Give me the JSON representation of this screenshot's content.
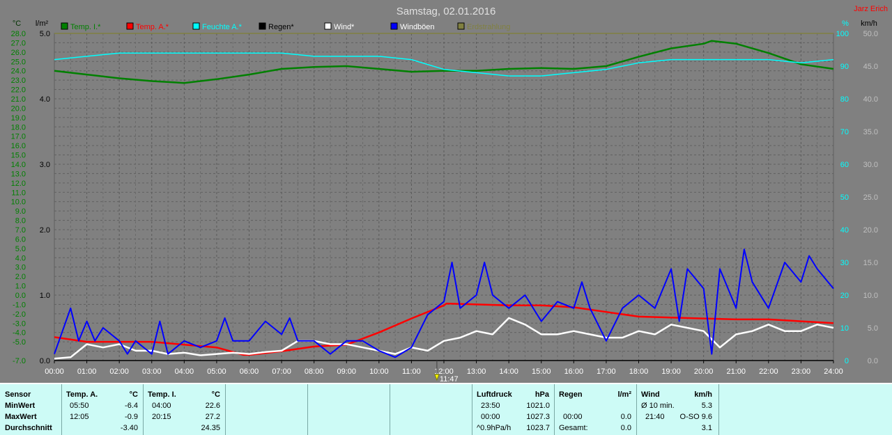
{
  "header": {
    "title": "Samstag, 02.01.2016",
    "author": "Jarz Erich"
  },
  "axes": {
    "left_unit_1": "°C",
    "left_unit_2": "l/m²",
    "right_unit_1": "%",
    "right_unit_2": "km/h",
    "temp_ticks": [
      "28.0",
      "27.0",
      "26.0",
      "25.0",
      "24.0",
      "23.0",
      "22.0",
      "21.0",
      "20.0",
      "19.0",
      "18.0",
      "17.0",
      "16.0",
      "15.0",
      "14.0",
      "13.0",
      "12.0",
      "11.0",
      "10.0",
      "9.0",
      "8.0",
      "7.0",
      "6.0",
      "5.0",
      "4.0",
      "3.0",
      "2.0",
      "1.0",
      "0.0",
      "-1.0",
      "-2.0",
      "-3.0",
      "-4.0",
      "-5.0",
      "-7.0"
    ],
    "rain_ticks": [
      "5.0",
      "4.0",
      "3.0",
      "2.0",
      "1.0",
      "0.0"
    ],
    "humidity_ticks": [
      "100",
      "90",
      "80",
      "70",
      "60",
      "50",
      "40",
      "30",
      "20",
      "10",
      "0"
    ],
    "wind_ticks": [
      "50.0",
      "45.0",
      "40.0",
      "35.0",
      "30.0",
      "25.0",
      "20.0",
      "15.0",
      "10.0",
      "5.0",
      "0.0"
    ],
    "time_ticks": [
      "00:00",
      "01:00",
      "02:00",
      "03:00",
      "04:00",
      "05:00",
      "06:00",
      "07:00",
      "08:00",
      "09:00",
      "10:00",
      "11:00",
      "12:00",
      "13:00",
      "14:00",
      "15:00",
      "16:00",
      "17:00",
      "18:00",
      "19:00",
      "20:00",
      "21:00",
      "22:00",
      "23:00",
      "24:00"
    ],
    "marker_label": "11:47"
  },
  "colors": {
    "temp_indoor": "#008000",
    "temp_outdoor": "#ff0000",
    "humidity": "#00ffff",
    "rain": "#000000",
    "wind": "#ffffff",
    "gusts": "#0000ff",
    "lightning": "#808040",
    "axis_temp": "#008000",
    "axis_rain": "#000000",
    "axis_humidity": "#00ffff",
    "axis_wind": "#c0c0c0"
  },
  "chart_data": {
    "type": "line",
    "title": "Samstag, 02.01.2016",
    "x_range": [
      "00:00",
      "24:00"
    ],
    "y_temp_range": [
      -7.0,
      28.0
    ],
    "y_rain_range": [
      0.0,
      5.0
    ],
    "y_humidity_range": [
      0,
      100
    ],
    "y_wind_range": [
      0.0,
      50.0
    ],
    "grid": true,
    "legend_position": "top",
    "series": [
      {
        "name": "Temp. I.*",
        "color_key": "temp_indoor",
        "axis": "temp",
        "x": [
          0,
          1,
          2,
          3,
          4,
          5,
          6,
          7,
          8,
          9,
          10,
          11,
          12,
          13,
          14,
          15,
          16,
          17,
          18,
          19,
          20,
          20.25,
          21,
          22,
          23,
          24
        ],
        "y": [
          24.0,
          23.6,
          23.2,
          22.9,
          22.7,
          23.1,
          23.6,
          24.2,
          24.4,
          24.5,
          24.2,
          23.9,
          24.0,
          24.0,
          24.2,
          24.3,
          24.2,
          24.5,
          25.5,
          26.4,
          26.9,
          27.2,
          26.9,
          25.9,
          24.7,
          24.2
        ]
      },
      {
        "name": "Temp. A.*",
        "color_key": "temp_outdoor",
        "axis": "temp",
        "x": [
          0,
          1,
          2,
          3,
          4,
          5,
          5.83,
          6,
          7,
          8,
          9,
          10,
          11,
          12,
          12.08,
          13,
          14,
          15,
          16,
          17,
          18,
          19,
          20,
          21,
          22,
          23,
          24
        ],
        "y": [
          -4.5,
          -5.0,
          -5.0,
          -5.0,
          -5.3,
          -5.6,
          -6.4,
          -6.4,
          -6.0,
          -5.5,
          -5.3,
          -4.0,
          -2.5,
          -1.1,
          -0.9,
          -1.0,
          -1.1,
          -1.1,
          -1.3,
          -1.8,
          -2.3,
          -2.4,
          -2.5,
          -2.6,
          -2.6,
          -2.8,
          -3.0
        ]
      },
      {
        "name": "Feuchte A.*",
        "color_key": "humidity",
        "axis": "humidity",
        "x": [
          0,
          1,
          2,
          3,
          4,
          5,
          6,
          7,
          8,
          9,
          10,
          11,
          12,
          13,
          14,
          15,
          16,
          17,
          18,
          19,
          20,
          21,
          22,
          23,
          24
        ],
        "y": [
          92,
          93,
          94,
          94,
          94,
          94,
          94,
          94,
          93,
          93,
          93,
          92,
          89,
          88,
          87,
          87,
          88,
          89,
          91,
          92,
          92,
          92,
          92,
          91,
          92
        ]
      },
      {
        "name": "Regen*",
        "color_key": "rain",
        "axis": "rain",
        "x": [
          0,
          24
        ],
        "y": [
          0.0,
          0.0
        ]
      },
      {
        "name": "Wind*",
        "color_key": "wind",
        "axis": "wind",
        "x": [
          0,
          0.5,
          1,
          1.5,
          2,
          2.5,
          3,
          3.5,
          4,
          4.5,
          5,
          5.5,
          6,
          6.5,
          7,
          7.5,
          8,
          8.5,
          9,
          9.5,
          10,
          10.5,
          11,
          11.5,
          12,
          12.5,
          13,
          13.5,
          14,
          14.5,
          15,
          15.5,
          16,
          16.5,
          17,
          17.5,
          18,
          18.5,
          19,
          19.5,
          20,
          20.5,
          21,
          21.5,
          22,
          22.5,
          23,
          23.5,
          24
        ],
        "y": [
          0.3,
          0.5,
          2.5,
          2.0,
          2.5,
          1.5,
          1.5,
          1.0,
          1.2,
          0.8,
          1.0,
          1.2,
          1.0,
          1.3,
          1.5,
          3.0,
          3.0,
          2.5,
          2.5,
          2.0,
          1.5,
          1.0,
          2.0,
          1.5,
          3.0,
          3.5,
          4.5,
          4.0,
          6.5,
          5.5,
          4.0,
          4.0,
          4.5,
          4.0,
          3.5,
          3.5,
          4.5,
          4.0,
          5.5,
          5.0,
          4.5,
          2.0,
          4.0,
          4.5,
          5.5,
          4.5,
          4.5,
          5.5,
          5.0
        ]
      },
      {
        "name": "Windböen",
        "color_key": "gusts",
        "axis": "wind",
        "x": [
          0,
          0.5,
          0.75,
          1,
          1.25,
          1.5,
          2,
          2.25,
          2.5,
          3,
          3.25,
          3.5,
          4,
          4.5,
          5,
          5.25,
          5.5,
          6,
          6.5,
          7,
          7.25,
          7.5,
          8,
          8.5,
          9,
          9.5,
          10,
          10.5,
          11,
          11.5,
          12,
          12.25,
          12.5,
          13,
          13.25,
          13.5,
          14,
          14.5,
          15,
          15.5,
          16,
          16.25,
          16.5,
          17,
          17.5,
          18,
          18.5,
          19,
          19.25,
          19.5,
          20,
          20.25,
          20.5,
          21,
          21.25,
          21.5,
          22,
          22.5,
          23,
          23.25,
          23.5,
          24
        ],
        "y": [
          1.0,
          8.0,
          3.0,
          6.0,
          3.0,
          5.0,
          3.0,
          1.0,
          3.0,
          1.0,
          6.0,
          1.0,
          3.0,
          2.0,
          3.0,
          6.5,
          3.0,
          3.0,
          6.0,
          4.0,
          6.5,
          3.0,
          3.0,
          1.0,
          3.0,
          3.0,
          1.5,
          0.5,
          2.0,
          7.0,
          9.0,
          15.0,
          8.0,
          10.0,
          15.0,
          10.0,
          8.0,
          10.0,
          6.0,
          9.0,
          8.0,
          12.0,
          8.0,
          3.0,
          8.0,
          10.0,
          8.0,
          14.0,
          6.0,
          14.0,
          11.0,
          1.0,
          14.0,
          8.0,
          17.0,
          12.0,
          8.0,
          15.0,
          12.0,
          16.0,
          14.0,
          11.0
        ]
      },
      {
        "name": "Erdstrahlung",
        "color_key": "lightning",
        "axis": "humidity",
        "x": [
          0,
          24
        ],
        "y": [
          100,
          100
        ]
      }
    ]
  },
  "footer": {
    "sensor_label": "Sensor",
    "minwert_label": "MinWert",
    "maxwert_label": "MaxWert",
    "durchschnitt_label": "Durchschnitt",
    "temp_a": {
      "title": "Temp. A.",
      "unit": "°C",
      "min_time": "05:50",
      "min_val": "-6.4",
      "max_time": "12:05",
      "max_val": "-0.9",
      "avg": "-3.40"
    },
    "temp_i": {
      "title": "Temp. I.",
      "unit": "°C",
      "min_time": "04:00",
      "min_val": "22.6",
      "max_time": "20:15",
      "max_val": "27.2",
      "avg": "24.35"
    },
    "pressure": {
      "title": "Luftdruck",
      "unit": "hPa",
      "min_time": "23:50",
      "min_val": "1021.0",
      "max_time": "00:00",
      "max_val": "1027.3",
      "trend_label": "^0.9hPa/h",
      "avg": "1023.7"
    },
    "rain": {
      "title": "Regen",
      "unit": "l/m²",
      "max_time": "00:00",
      "max_val": "0.0",
      "total_label": "Gesamt:",
      "total_val": "0.0"
    },
    "wind": {
      "title": "Wind",
      "unit": "km/h",
      "avg10_label": "Ø 10 min.",
      "avg10_val": "5.3",
      "max_time": "21:40",
      "max_dir_val": "O-SO 9.6",
      "avg": "3.1"
    }
  }
}
